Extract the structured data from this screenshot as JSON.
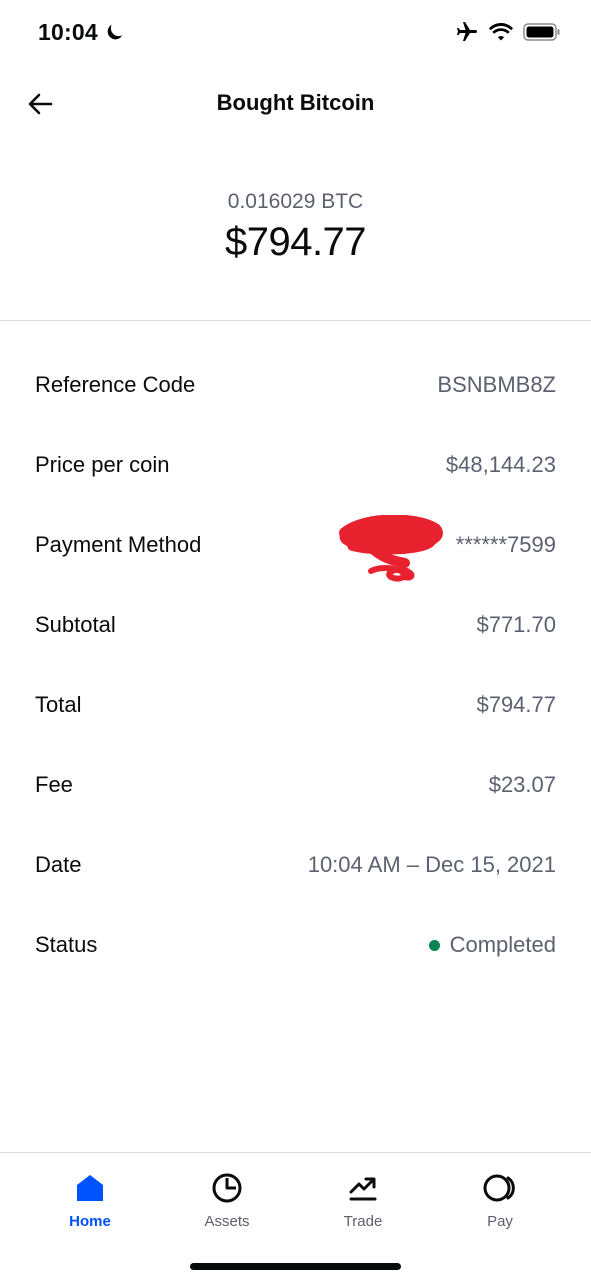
{
  "status_bar": {
    "time": "10:04"
  },
  "header": {
    "title": "Bought Bitcoin"
  },
  "summary": {
    "crypto_amount": "0.016029 BTC",
    "fiat_amount": "$794.77"
  },
  "details": [
    {
      "label": "Reference Code",
      "value": "BSNBMB8Z"
    },
    {
      "label": "Price per coin",
      "value": "$48,144.23"
    },
    {
      "label": "Payment Method",
      "value": "******7599"
    },
    {
      "label": "Subtotal",
      "value": "$771.70"
    },
    {
      "label": "Total",
      "value": "$794.77"
    },
    {
      "label": "Fee",
      "value": "$23.07"
    },
    {
      "label": "Date",
      "value": "10:04 AM – Dec 15, 2021"
    },
    {
      "label": "Status",
      "value": "Completed"
    }
  ],
  "tabs": [
    {
      "label": "Home",
      "icon": "home-icon",
      "active": true
    },
    {
      "label": "Assets",
      "icon": "pie-chart-icon",
      "active": false
    },
    {
      "label": "Trade",
      "icon": "trend-up-icon",
      "active": false
    },
    {
      "label": "Pay",
      "icon": "pay-icon",
      "active": false
    }
  ],
  "colors": {
    "accent": "#0052ff",
    "status_completed": "#098551",
    "redaction": "#e8212f",
    "muted_text": "#5b616e"
  }
}
